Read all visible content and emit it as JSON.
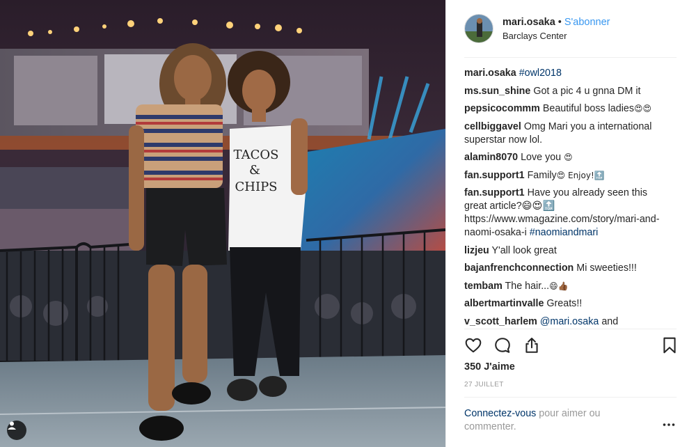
{
  "header": {
    "username": "mari.osaka",
    "separator": "•",
    "follow_label": "S'abonner",
    "location": "Barclays Center"
  },
  "comments": [
    {
      "user": "mari.osaka",
      "text": "",
      "link": "#owl2018",
      "emoji": ""
    },
    {
      "user": "ms.sun_shine",
      "text": "Got a pic 4 u gnna DM it",
      "link": "",
      "emoji": ""
    },
    {
      "user": "pepsicocommm",
      "text": "Beautiful boss ladies",
      "link": "",
      "emoji": "😍😍"
    },
    {
      "user": "cellbiggavel",
      "text": "Omg Mari you a international superstar now lol.",
      "link": "",
      "emoji": ""
    },
    {
      "user": "alamin8070",
      "text": "Love you",
      "link": "",
      "emoji": "😍"
    },
    {
      "user": "fan.support1",
      "text": "Family",
      "link": "",
      "emoji": "😍 Enjoy!🔝"
    },
    {
      "user": "fan.support1",
      "text": "Have you already seen this great article?😄😍🔝 https://www.wmagazine.com/story/mari-and-naomi-osaka-i",
      "link": "#naomiandmari",
      "emoji": ""
    },
    {
      "user": "lizjeu",
      "text": "Y'all look great",
      "link": "",
      "emoji": ""
    },
    {
      "user": "bajanfrenchconnection",
      "text": "Mi sweeties!!!",
      "link": "",
      "emoji": ""
    },
    {
      "user": "tembam",
      "text": "The hair...",
      "link": "",
      "emoji": "😄👍🏾"
    },
    {
      "user": "albertmartinvalle",
      "text": "Greats!!",
      "link": "",
      "emoji": ""
    },
    {
      "user": "v_scott_harlem",
      "text": "and",
      "link": "@mari.osaka",
      "emoji": ""
    }
  ],
  "actions": {
    "like_icon": "heart-icon",
    "comment_icon": "comment-bubble-icon",
    "share_icon": "share-icon",
    "save_icon": "bookmark-icon"
  },
  "likes": "350 J'aime",
  "date": "27 JUILLET",
  "login_prompt": {
    "link": "Connectez-vous",
    "text": " pour aimer ou commenter."
  },
  "more_icon": "more-options-icon",
  "photo_caption_shirt": [
    "TACOS",
    "&",
    "CHIPS"
  ],
  "colors": {
    "accent": "#3897f0",
    "link": "#003569",
    "muted": "#999999",
    "text": "#262626"
  }
}
